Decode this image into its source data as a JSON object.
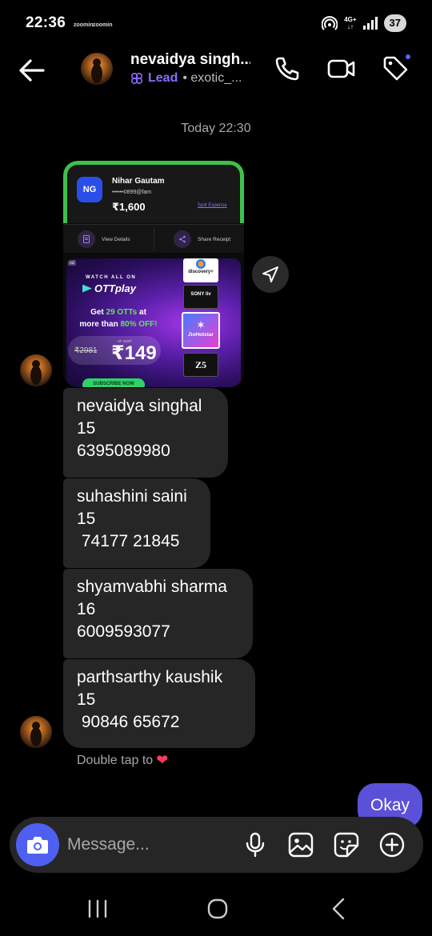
{
  "status_bar": {
    "time": "22:36",
    "mini_left": "zoomin",
    "mini_right": "zoomin",
    "network": "4G+",
    "battery": "37"
  },
  "header": {
    "name": "nevaidya singh...",
    "lead_label": "Lead",
    "username": "• exotic_..."
  },
  "timestamp": "Today 22:30",
  "payment_card": {
    "avatar_initials": "NG",
    "name": "Nihar Gautam",
    "upi": "••••••0899@fam",
    "amount": "₹1,600",
    "split_label": "Split Expense",
    "view_details": "View Details",
    "share_receipt": "Share Receipt"
  },
  "ad": {
    "tag": "Ad",
    "watch_all_on": "WATCH ALL ON",
    "brand": "OTTplay",
    "offer_prefix": "Get",
    "offer_count": "29 OTTs",
    "offer_mid": "at more than",
    "offer_pct": "80% OFF!",
    "old_price": "₹2981",
    "at_just": "AT JUST",
    "price": "₹149",
    "cta": "SUBSCRIBE NOW",
    "logos": [
      "discovery+",
      "SONY liv",
      "JioHotstar",
      "Z5"
    ]
  },
  "messages": [
    {
      "text": "nevaidya singhal\n15\n6395089980"
    },
    {
      "text": "suhashini saini\n15\n 74177 21845"
    },
    {
      "text": "shyamvabhi sharma\n16\n6009593077"
    },
    {
      "text": "parthsarthy kaushik\n15\n 90846 65672"
    }
  ],
  "double_tap": "Double tap to",
  "outgoing": "Okay",
  "composer": {
    "placeholder": "Message..."
  },
  "colors": {
    "accent": "#5b51d8",
    "camera_button": "#4f5ff2",
    "lead": "#8c6cff",
    "bubble": "#262626",
    "pay_border": "#3ec04d"
  }
}
